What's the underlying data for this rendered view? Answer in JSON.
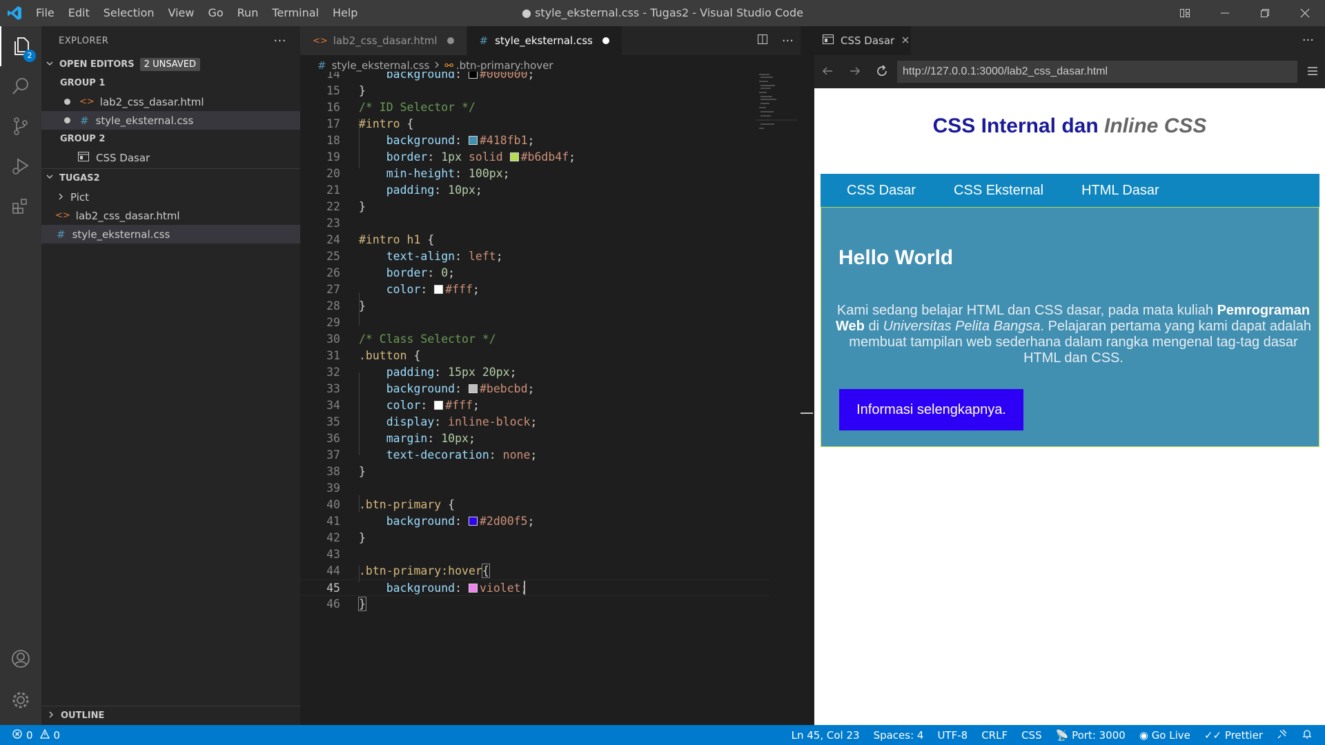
{
  "titlebar": {
    "menu": [
      "File",
      "Edit",
      "Selection",
      "View",
      "Go",
      "Run",
      "Terminal",
      "Help"
    ],
    "title": "● style_eksternal.css - Tugas2 - Visual Studio Code"
  },
  "activity": {
    "explorer_badge": "2"
  },
  "sidebar": {
    "header": "EXPLORER",
    "open_editors": {
      "title": "OPEN EDITORS",
      "badge": "2 UNSAVED"
    },
    "group1": {
      "title": "GROUP 1",
      "files": [
        "lab2_css_dasar.html",
        "style_eksternal.css"
      ]
    },
    "group2": {
      "title": "GROUP 2",
      "files": [
        "CSS Dasar"
      ]
    },
    "workspace": {
      "title": "TUGAS2",
      "items": [
        "Pict",
        "lab2_css_dasar.html",
        "style_eksternal.css"
      ]
    },
    "outline": "OUTLINE"
  },
  "editor": {
    "tabs": [
      "lab2_css_dasar.html",
      "style_eksternal.css"
    ],
    "breadcrumb": {
      "file": "style_eksternal.css",
      "symbol": ".btn-primary:hover"
    },
    "swatches": {
      "black": "#000000",
      "blue": "#418fb1",
      "green": "#b6db4f",
      "white": "#ffffff",
      "grey": "#bebcbd",
      "primary": "#2d00f5",
      "violet": "#ee82ee"
    }
  },
  "preview": {
    "tab_title": "CSS Dasar",
    "url": "http://127.0.0.1:3000/lab2_css_dasar.html",
    "heading_plain": "CSS Internal dan ",
    "heading_italic": "Inline CSS",
    "nav": [
      "CSS Dasar",
      "CSS Eksternal",
      "HTML Dasar"
    ],
    "intro_title": "Hello World",
    "para_1": "Kami sedang belajar HTML dan CSS dasar, pada mata kuliah ",
    "para_bold": "Pemrograman Web",
    "para_2": " di ",
    "para_italic": "Universitas Pelita Bangsa",
    "para_3": ". Pelajaran pertama yang kami dapat adalah membuat tampilan web sederhana dalam rangka mengenal tag-tag dasar HTML dan CSS.",
    "button": "Informasi selengkapnya."
  },
  "statusbar": {
    "errors": "0",
    "warnings": "0",
    "position": "Ln 45, Col 23",
    "spaces": "Spaces: 4",
    "encoding": "UTF-8",
    "eol": "CRLF",
    "language": "CSS",
    "port": "Port: 3000",
    "golive": "Go Live",
    "prettier": "Prettier"
  }
}
